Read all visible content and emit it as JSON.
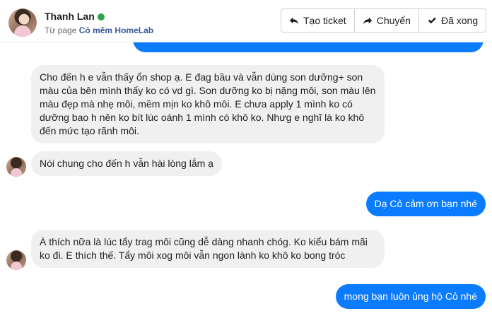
{
  "header": {
    "name": "Thanh Lan",
    "from_prefix": "Từ page",
    "page_name": "Cỏ mềm HomeLab",
    "online_color": "#31a24c",
    "actions": [
      {
        "label": "Tạo ticket",
        "icon": "reply-icon"
      },
      {
        "label": "Chuyển",
        "icon": "forward-icon"
      },
      {
        "label": "Đã xong",
        "icon": "check-icon"
      }
    ]
  },
  "messages": [
    {
      "side": "incoming",
      "text": "Cho đến h e vẫn thấy ổn shop ạ. E đag bầu và vẫn dùng son dưỡng+ son màu của bên mình thấy ko có vd gì. Son dưỡng ko bị nặng môi, son màu lên màu đẹp mà nhẹ môi, mềm mịn ko khô môi. E chưa apply 1 mình ko có dưỡng bao h nên ko bít lúc oánh 1 mình có khô ko. Nhưg e nghĩ là ko khô đến mức tạo rãnh môi."
    },
    {
      "side": "incoming",
      "text": "Nói chung cho đến h vẫn hài lòng lắm ạ"
    },
    {
      "side": "outgoing",
      "text": "Dạ Cỏ cảm ơn bạn nhé"
    },
    {
      "side": "incoming",
      "text": "À thích nữa là lúc tẩy trag môi cũng dễ dàng nhanh chóg. Ko kiểu bám mãi ko đi. E thích thế. Tẩy môi xog môi vẫn ngon lành ko khô ko bong tróc"
    },
    {
      "side": "outgoing",
      "text": "mong bạn luôn ủng hộ Cỏ nhé"
    }
  ],
  "colors": {
    "outgoing_bubble": "#0b7cff",
    "incoming_bubble": "#f0f0f0"
  }
}
